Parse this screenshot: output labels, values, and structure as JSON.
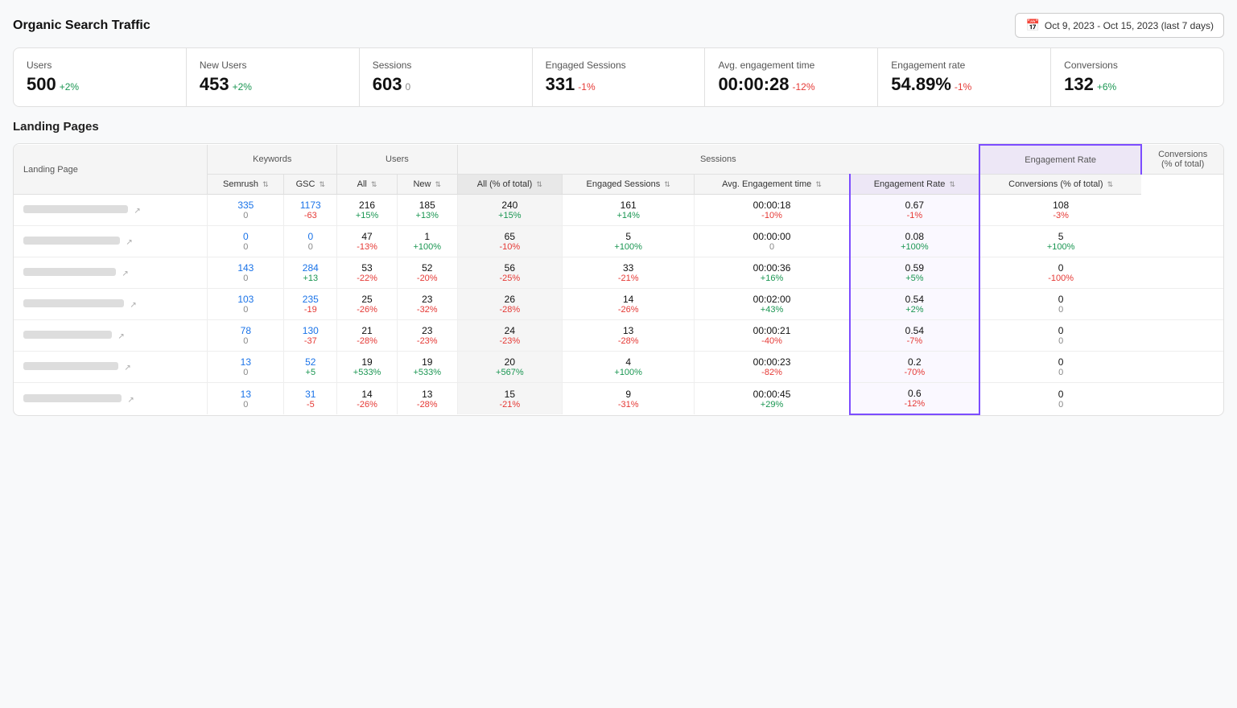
{
  "page": {
    "title": "Organic Search Traffic",
    "date_range": "Oct 9, 2023 - Oct 15, 2023 (last 7 days)"
  },
  "stats": [
    {
      "label": "Users",
      "value": "500",
      "delta": "+2%",
      "delta_type": "pos"
    },
    {
      "label": "New Users",
      "value": "453",
      "delta": "+2%",
      "delta_type": "pos"
    },
    {
      "label": "Sessions",
      "value": "603",
      "delta": "0",
      "delta_type": "neutral"
    },
    {
      "label": "Engaged Sessions",
      "value": "331",
      "delta": "-1%",
      "delta_type": "neg"
    },
    {
      "label": "Avg. engagement time",
      "value": "00:00:28",
      "delta": "-12%",
      "delta_type": "neg"
    },
    {
      "label": "Engagement rate",
      "value": "54.89%",
      "delta": "-1%",
      "delta_type": "neg"
    },
    {
      "label": "Conversions",
      "value": "132",
      "delta": "+6%",
      "delta_type": "pos"
    }
  ],
  "table": {
    "section_title": "Landing Pages",
    "col_groups": [
      {
        "label": "Landing Page",
        "colspan": 1,
        "type": "plain"
      },
      {
        "label": "Keywords",
        "colspan": 2,
        "type": "plain"
      },
      {
        "label": "Users",
        "colspan": 2,
        "type": "plain"
      },
      {
        "label": "Sessions",
        "colspan": 4,
        "type": "plain"
      },
      {
        "label": "Engagement Rate",
        "colspan": 1,
        "type": "highlight"
      },
      {
        "label": "Conversions (% of total)",
        "colspan": 1,
        "type": "plain"
      }
    ],
    "sub_headers": [
      {
        "label": "Landing Page",
        "type": "landing"
      },
      {
        "label": "Semrush",
        "type": "plain",
        "sort": true
      },
      {
        "label": "GSC",
        "type": "plain",
        "sort": true
      },
      {
        "label": "All",
        "type": "plain",
        "sort": true
      },
      {
        "label": "New",
        "type": "plain",
        "sort": true
      },
      {
        "label": "All (% of total)",
        "type": "plain",
        "sort": true
      },
      {
        "label": "Engaged Sessions",
        "type": "plain",
        "sort": true
      },
      {
        "label": "Avg. Engagement time",
        "type": "plain",
        "sort": true
      },
      {
        "label": "Engagement Rate",
        "type": "highlight",
        "sort": true
      },
      {
        "label": "Conversions (% of total)",
        "type": "plain",
        "sort": true
      }
    ],
    "rows": [
      {
        "semrush_main": "335",
        "semrush_sub": "0",
        "semrush_sub_type": "neutral",
        "gsc_main": "1173",
        "gsc_sub": "-63",
        "gsc_sub_type": "neg",
        "users_all_main": "216",
        "users_all_sub": "+15%",
        "users_all_sub_type": "pos",
        "users_new_main": "185",
        "users_new_sub": "+13%",
        "users_new_sub_type": "pos",
        "sessions_all_main": "240",
        "sessions_all_sub": "+15%",
        "sessions_all_sub_type": "pos",
        "engaged_main": "161",
        "engaged_sub": "+14%",
        "engaged_sub_type": "pos",
        "avg_time_main": "00:00:18",
        "avg_time_sub": "-10%",
        "avg_time_sub_type": "neg",
        "eng_rate_main": "0.67",
        "eng_rate_sub": "-1%",
        "eng_rate_sub_type": "neg",
        "conv_main": "108",
        "conv_sub": "-3%",
        "conv_sub_type": "neg"
      },
      {
        "semrush_main": "0",
        "semrush_sub": "0",
        "semrush_sub_type": "neutral",
        "gsc_main": "0",
        "gsc_sub": "0",
        "gsc_sub_type": "neutral",
        "users_all_main": "47",
        "users_all_sub": "-13%",
        "users_all_sub_type": "neg",
        "users_new_main": "1",
        "users_new_sub": "+100%",
        "users_new_sub_type": "pos",
        "sessions_all_main": "65",
        "sessions_all_sub": "-10%",
        "sessions_all_sub_type": "neg",
        "engaged_main": "5",
        "engaged_sub": "+100%",
        "engaged_sub_type": "pos",
        "avg_time_main": "00:00:00",
        "avg_time_sub": "0",
        "avg_time_sub_type": "neutral",
        "eng_rate_main": "0.08",
        "eng_rate_sub": "+100%",
        "eng_rate_sub_type": "pos",
        "conv_main": "5",
        "conv_sub": "+100%",
        "conv_sub_type": "pos"
      },
      {
        "semrush_main": "143",
        "semrush_sub": "0",
        "semrush_sub_type": "neutral",
        "gsc_main": "284",
        "gsc_sub": "+13",
        "gsc_sub_type": "pos",
        "users_all_main": "53",
        "users_all_sub": "-22%",
        "users_all_sub_type": "neg",
        "users_new_main": "52",
        "users_new_sub": "-20%",
        "users_new_sub_type": "neg",
        "sessions_all_main": "56",
        "sessions_all_sub": "-25%",
        "sessions_all_sub_type": "neg",
        "engaged_main": "33",
        "engaged_sub": "-21%",
        "engaged_sub_type": "neg",
        "avg_time_main": "00:00:36",
        "avg_time_sub": "+16%",
        "avg_time_sub_type": "pos",
        "eng_rate_main": "0.59",
        "eng_rate_sub": "+5%",
        "eng_rate_sub_type": "pos",
        "conv_main": "0",
        "conv_sub": "-100%",
        "conv_sub_type": "neg"
      },
      {
        "semrush_main": "103",
        "semrush_sub": "0",
        "semrush_sub_type": "neutral",
        "gsc_main": "235",
        "gsc_sub": "-19",
        "gsc_sub_type": "neg",
        "users_all_main": "25",
        "users_all_sub": "-26%",
        "users_all_sub_type": "neg",
        "users_new_main": "23",
        "users_new_sub": "-32%",
        "users_new_sub_type": "neg",
        "sessions_all_main": "26",
        "sessions_all_sub": "-28%",
        "sessions_all_sub_type": "neg",
        "engaged_main": "14",
        "engaged_sub": "-26%",
        "engaged_sub_type": "neg",
        "avg_time_main": "00:02:00",
        "avg_time_sub": "+43%",
        "avg_time_sub_type": "pos",
        "eng_rate_main": "0.54",
        "eng_rate_sub": "+2%",
        "eng_rate_sub_type": "pos",
        "conv_main": "0",
        "conv_sub": "0",
        "conv_sub_type": "neutral"
      },
      {
        "semrush_main": "78",
        "semrush_sub": "0",
        "semrush_sub_type": "neutral",
        "gsc_main": "130",
        "gsc_sub": "-37",
        "gsc_sub_type": "neg",
        "users_all_main": "21",
        "users_all_sub": "-28%",
        "users_all_sub_type": "neg",
        "users_new_main": "23",
        "users_new_sub": "-23%",
        "users_new_sub_type": "neg",
        "sessions_all_main": "24",
        "sessions_all_sub": "-23%",
        "sessions_all_sub_type": "neg",
        "engaged_main": "13",
        "engaged_sub": "-28%",
        "engaged_sub_type": "neg",
        "avg_time_main": "00:00:21",
        "avg_time_sub": "-40%",
        "avg_time_sub_type": "neg",
        "eng_rate_main": "0.54",
        "eng_rate_sub": "-7%",
        "eng_rate_sub_type": "neg",
        "conv_main": "0",
        "conv_sub": "0",
        "conv_sub_type": "neutral"
      },
      {
        "semrush_main": "13",
        "semrush_sub": "0",
        "semrush_sub_type": "neutral",
        "gsc_main": "52",
        "gsc_sub": "+5",
        "gsc_sub_type": "pos",
        "users_all_main": "19",
        "users_all_sub": "+533%",
        "users_all_sub_type": "pos",
        "users_new_main": "19",
        "users_new_sub": "+533%",
        "users_new_sub_type": "pos",
        "sessions_all_main": "20",
        "sessions_all_sub": "+567%",
        "sessions_all_sub_type": "pos",
        "engaged_main": "4",
        "engaged_sub": "+100%",
        "engaged_sub_type": "pos",
        "avg_time_main": "00:00:23",
        "avg_time_sub": "-82%",
        "avg_time_sub_type": "neg",
        "eng_rate_main": "0.2",
        "eng_rate_sub": "-70%",
        "eng_rate_sub_type": "neg",
        "conv_main": "0",
        "conv_sub": "0",
        "conv_sub_type": "neutral"
      },
      {
        "semrush_main": "13",
        "semrush_sub": "0",
        "semrush_sub_type": "neutral",
        "gsc_main": "31",
        "gsc_sub": "-5",
        "gsc_sub_type": "neg",
        "users_all_main": "14",
        "users_all_sub": "-26%",
        "users_all_sub_type": "neg",
        "users_new_main": "13",
        "users_new_sub": "-28%",
        "users_new_sub_type": "neg",
        "sessions_all_main": "15",
        "sessions_all_sub": "-21%",
        "sessions_all_sub_type": "neg",
        "engaged_main": "9",
        "engaged_sub": "-31%",
        "engaged_sub_type": "neg",
        "avg_time_main": "00:00:45",
        "avg_time_sub": "+29%",
        "avg_time_sub_type": "pos",
        "eng_rate_main": "0.6",
        "eng_rate_sub": "-12%",
        "eng_rate_sub_type": "neg",
        "conv_main": "0",
        "conv_sub": "0",
        "conv_sub_type": "neutral"
      }
    ]
  }
}
